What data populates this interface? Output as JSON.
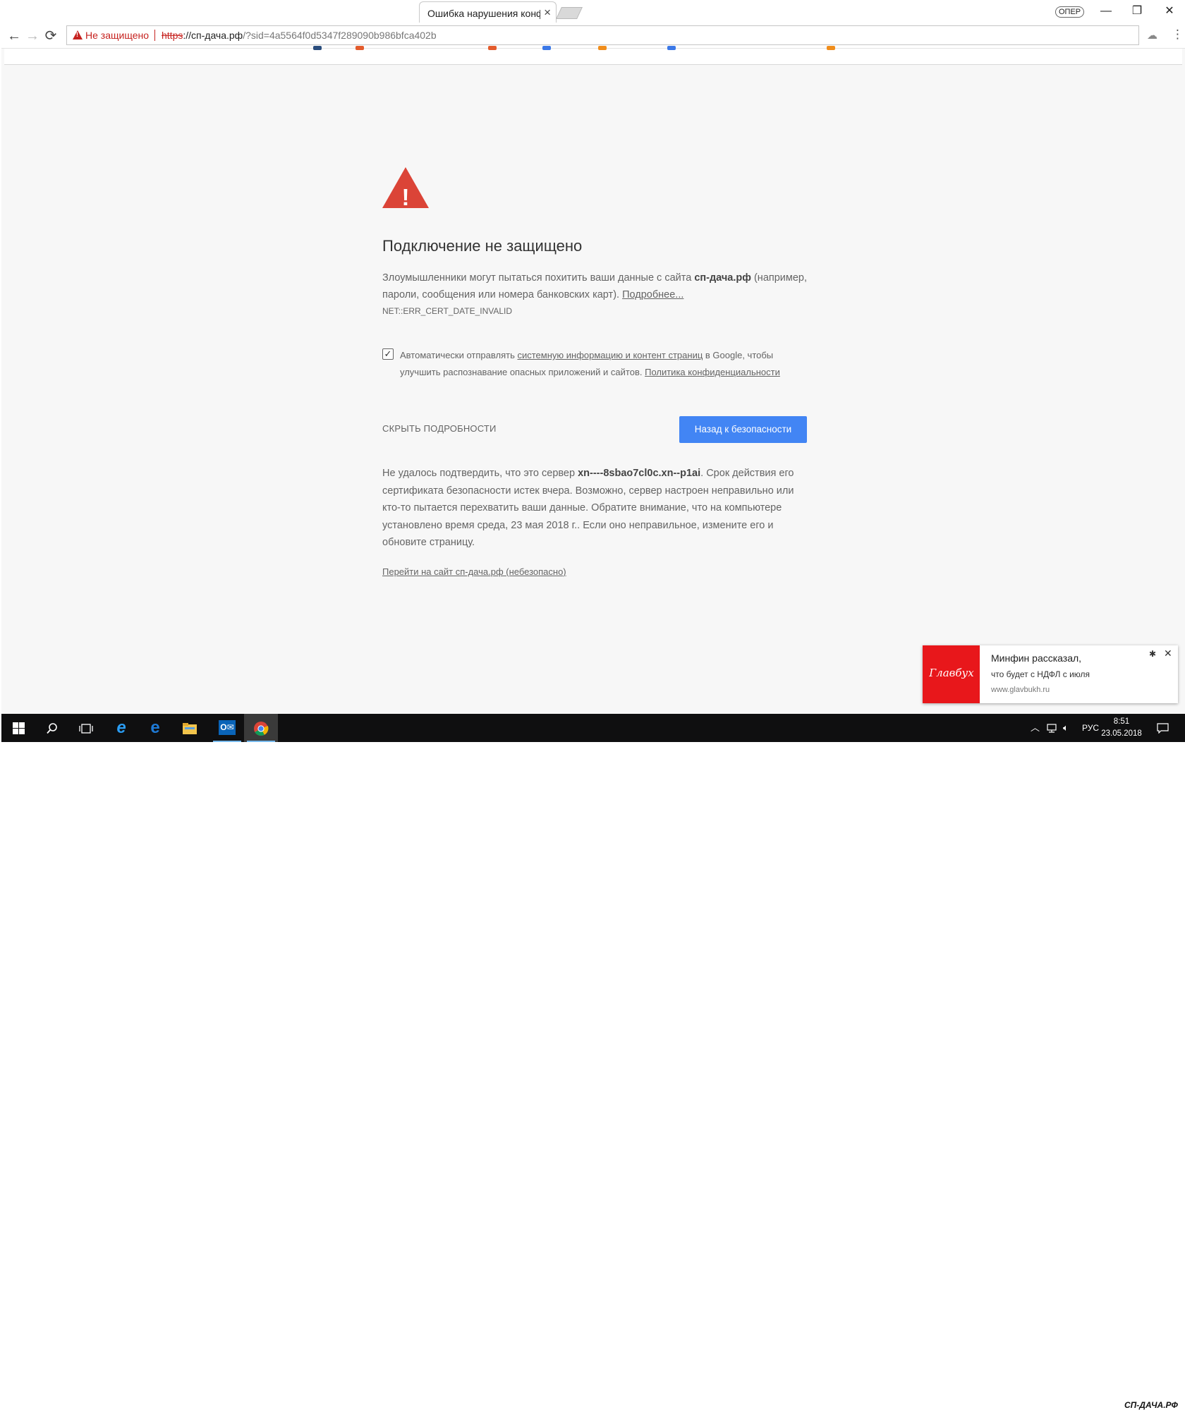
{
  "browser": {
    "tab_title": "Ошибка нарушения конфиденциальности",
    "tab_close": "×",
    "profile_label": "ОПЕР",
    "window_controls": {
      "minimize": "—",
      "restore": "❐",
      "close": "✕"
    },
    "nav": {
      "back": "←",
      "forward": "→",
      "reload": "⟳"
    },
    "omnibox": {
      "security_label": "Не защищено",
      "url_scheme": "https",
      "url_host": "://сп-дача.рф",
      "url_path": "/?sid=4a5564f0d5347f289090b986bfca402b"
    },
    "bookmark_star": "★",
    "extension_icon": "☁",
    "menu_icon": "⋮"
  },
  "interstitial": {
    "heading": "Подключение не защищено",
    "para_start": "Злоумышленники могут пытаться похитить ваши данные с сайта ",
    "para_site": "сп-дача.рф",
    "para_end": " (например, пароли, сообщения или номера банковских карт). ",
    "more_link": "Подробнее...",
    "error_code": "NET::ERR_CERT_DATE_INVALID",
    "optin_checked": true,
    "optin_start": "Автоматически отправлять ",
    "optin_link": "системную информацию и контент страниц",
    "optin_middle": " в Google, чтобы улучшить распознавание опасных приложений и сайтов. ",
    "optin_privacy_link": "Политика конфиденциальности",
    "details_button": "СКРЫТЬ ПОДРОБНОСТИ",
    "back_button": "Назад к безопасности",
    "detail_start": "Не удалось подтвердить, что это сервер ",
    "detail_server": "xn----8sbao7cl0c.xn--p1ai",
    "detail_end": ". Срок действия его сертификата безопасности истек вчера. Возможно, сервер настроен неправильно или кто-то пытается перехватить ваши данные. Обратите внимание, что на компьютере установлено время среда, 23 мая 2018 г.. Если оно неправильное, измените его и обновите страницу.",
    "proceed_link": "Перейти на сайт сп-дача.рф (небезопасно)"
  },
  "notification": {
    "logo_text": "Главбух",
    "title": "Минфин рассказал,",
    "body": "что будет с НДФЛ с июля",
    "source": "www.glavbukh.ru",
    "settings_icon": "✱",
    "close_icon": "✕"
  },
  "taskbar": {
    "language": "РУС",
    "time": "8:51",
    "date": "23.05.2018"
  },
  "watermark": "СП-ДАЧА.РФ"
}
